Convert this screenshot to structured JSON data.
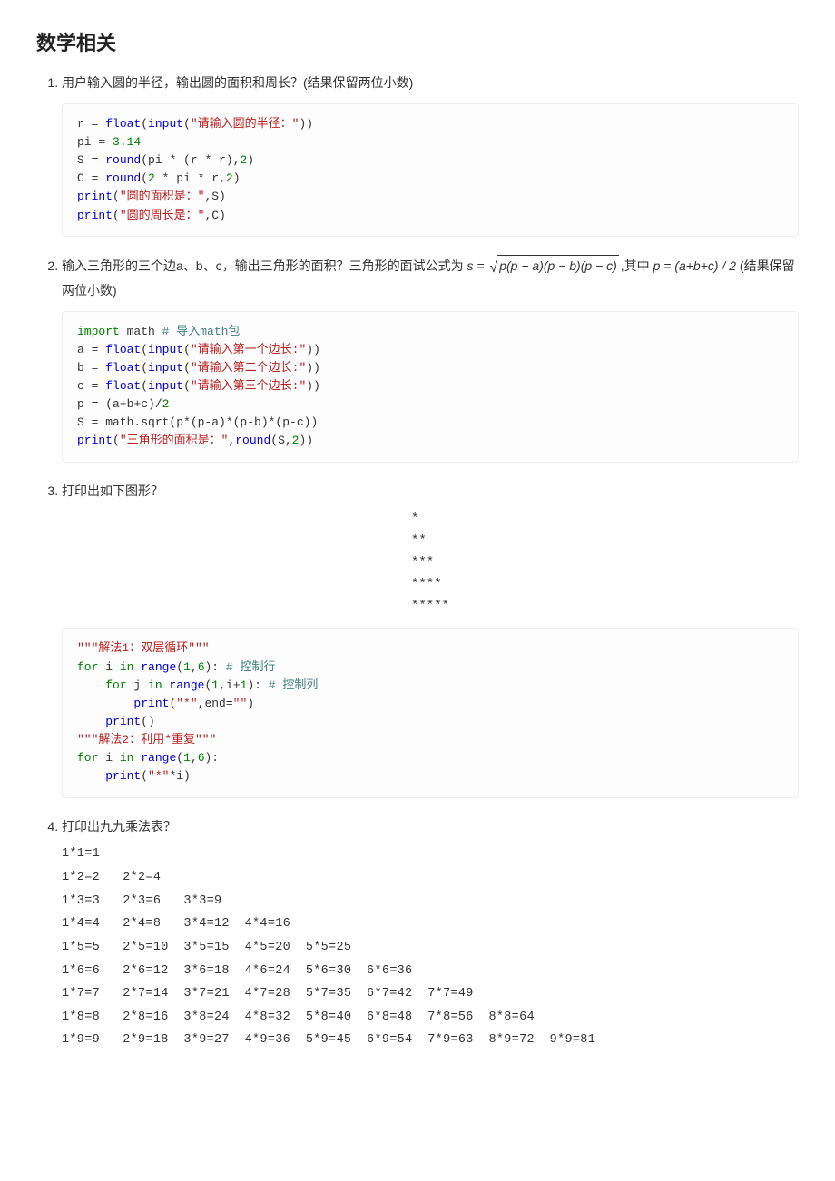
{
  "heading": "数学相关",
  "q1": {
    "text": "用户输入圆的半径，输出圆的面积和周长？(结果保留两位小数)",
    "code": "r = float(input(\"请输入圆的半径：\"))\npi = 3.14\nS = round(pi * (r * r),2)\nC = round(2 * pi * r,2)\nprint(\"圆的面积是：\",S)\nprint(\"圆的周长是：\",C)"
  },
  "q2": {
    "text_pre": "输入三角形的三个边a、b、c，输出三角形的面积？三角形的面试公式为 ",
    "formula_s": "s = ",
    "formula_body": "p(p − a)(p − b)(p − c)",
    "text_mid": ",其中 ",
    "formula_p": "p = (a+b+c) / 2",
    "text_end": " (结果保留两位小数)",
    "code": "import math # 导入math包\na = float(input(\"请输入第一个边长:\"))\nb = float(input(\"请输入第二个边长:\"))\nc = float(input(\"请输入第三个边长:\"))\np = (a+b+c)/2\nS = math.sqrt(p*(p-a)*(p-b)*(p-c))\nprint(\"三角形的面积是：\",round(S,2))"
  },
  "q3": {
    "text": "打印出如下图形？",
    "pattern": "*\n**\n***\n****\n*****",
    "code": "\"\"\"解法1：双层循环\"\"\"\nfor i in range(1,6): # 控制行\n    for j in range(1,i+1): # 控制列\n        print(\"*\",end=\"\")\n    print()\n\"\"\"解法2：利用*重复\"\"\"\nfor i in range(1,6):\n    print(\"*\"*i)"
  },
  "q4": {
    "text": "打印出九九乘法表？",
    "table": "1*1=1\n1*2=2   2*2=4\n1*3=3   2*3=6   3*3=9\n1*4=4   2*4=8   3*4=12  4*4=16\n1*5=5   2*5=10  3*5=15  4*5=20  5*5=25\n1*6=6   2*6=12  3*6=18  4*6=24  5*6=30  6*6=36\n1*7=7   2*7=14  3*7=21  4*7=28  5*7=35  6*7=42  7*7=49\n1*8=8   2*8=16  3*8=24  4*8=32  5*8=40  6*8=48  7*8=56  8*8=64\n1*9=9   2*9=18  3*9=27  4*9=36  5*9=45  6*9=54  7*9=63  8*9=72  9*9=81"
  }
}
